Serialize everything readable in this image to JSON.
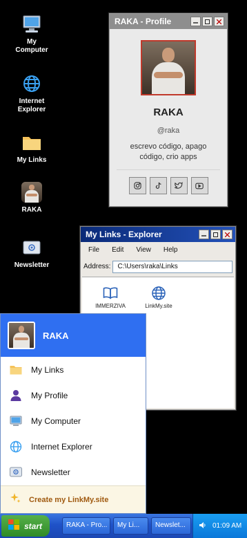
{
  "desktop": {
    "icons": [
      {
        "label": "My\nComputer",
        "icon": "computer-icon"
      },
      {
        "label": "Internet\nExplorer",
        "icon": "globe-icon"
      },
      {
        "label": "My Links",
        "icon": "folder-icon"
      },
      {
        "label": "RAKA",
        "icon": "avatar-icon"
      },
      {
        "label": "Newsletter",
        "icon": "mail-icon"
      }
    ]
  },
  "profile_window": {
    "title": "RAKA - Profile",
    "name": "RAKA",
    "handle": "@raka",
    "bio": "escrevo código, apago código, crio apps",
    "socials": [
      "instagram-icon",
      "tiktok-icon",
      "twitter-icon",
      "youtube-icon"
    ]
  },
  "explorer_window": {
    "title": "My Links - Explorer",
    "menu": [
      "File",
      "Edit",
      "View",
      "Help"
    ],
    "address_label": "Address:",
    "address_value": "C:\\Users\\raka\\Links",
    "files": [
      {
        "label": "IMMERZIVA",
        "icon": "book-icon"
      },
      {
        "label": "LinkMy.site",
        "icon": "globe-icon"
      }
    ]
  },
  "start_menu": {
    "user": "RAKA",
    "items": [
      {
        "label": "My Links",
        "icon": "folder-icon"
      },
      {
        "label": "My Profile",
        "icon": "user-icon"
      },
      {
        "label": "My Computer",
        "icon": "computer-icon"
      },
      {
        "label": "Internet Explorer",
        "icon": "globe-icon"
      },
      {
        "label": "Newsletter",
        "icon": "mail-icon"
      }
    ],
    "footer": "Create my LinkMy.site"
  },
  "taskbar": {
    "start_label": "start",
    "tasks": [
      "RAKA - Pro...",
      "My Li...",
      "Newslet..."
    ],
    "clock": "01:09 AM"
  },
  "colors": {
    "desktop": "#000000",
    "start_menu_header": "#2f6ff1",
    "taskbar": "#1f52c8",
    "start_button": "#3c9a32",
    "tray": "#0a77d9",
    "footer_text": "#a05a10"
  }
}
